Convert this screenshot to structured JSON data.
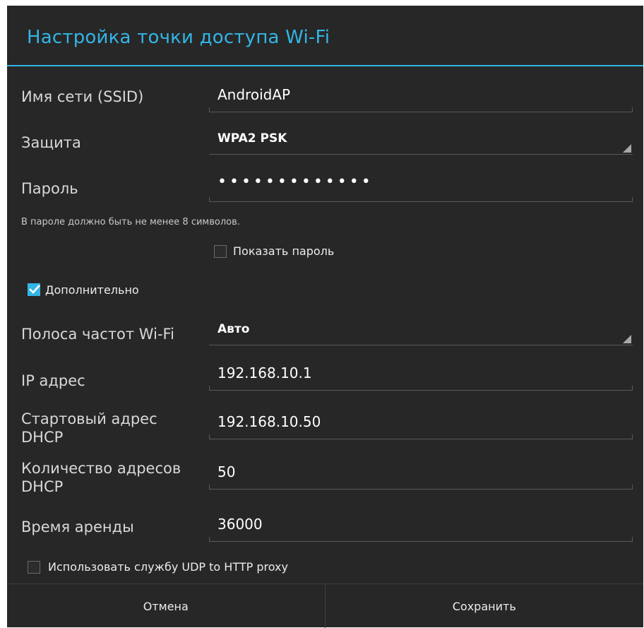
{
  "dialog": {
    "title": "Настройка точки доступа Wi-Fi",
    "accent_color": "#33b5e5",
    "background_color": "#272727"
  },
  "fields": {
    "ssid": {
      "label": "Имя сети (SSID)",
      "value": "AndroidAP"
    },
    "security": {
      "label": "Защита",
      "value": "WPA2 PSK"
    },
    "password": {
      "label": "Пароль",
      "value": "•••••••••••••"
    },
    "password_hint": "В пароле должно быть не менее 8 символов.",
    "show_password": {
      "label": "Показать пароль",
      "checked": false
    },
    "advanced": {
      "label": "Дополнительно",
      "checked": true
    },
    "band": {
      "label": "Полоса частот Wi-Fi",
      "value": "Авто"
    },
    "ip": {
      "label": "IP адрес",
      "value": "192.168.10.1"
    },
    "dhcp_start": {
      "label_line1": "Стартовый адрес",
      "label_line2": "DHCP",
      "value": "192.168.10.50"
    },
    "dhcp_count": {
      "label_line1": "Количество адресов",
      "label_line2": "DHCP",
      "value": "50"
    },
    "lease": {
      "label": "Время аренды",
      "value": "36000"
    },
    "udp_proxy": {
      "label": "Использовать службу UDP to HTTP proxy",
      "checked": false
    }
  },
  "buttons": {
    "cancel": "Отмена",
    "save": "Сохранить"
  }
}
